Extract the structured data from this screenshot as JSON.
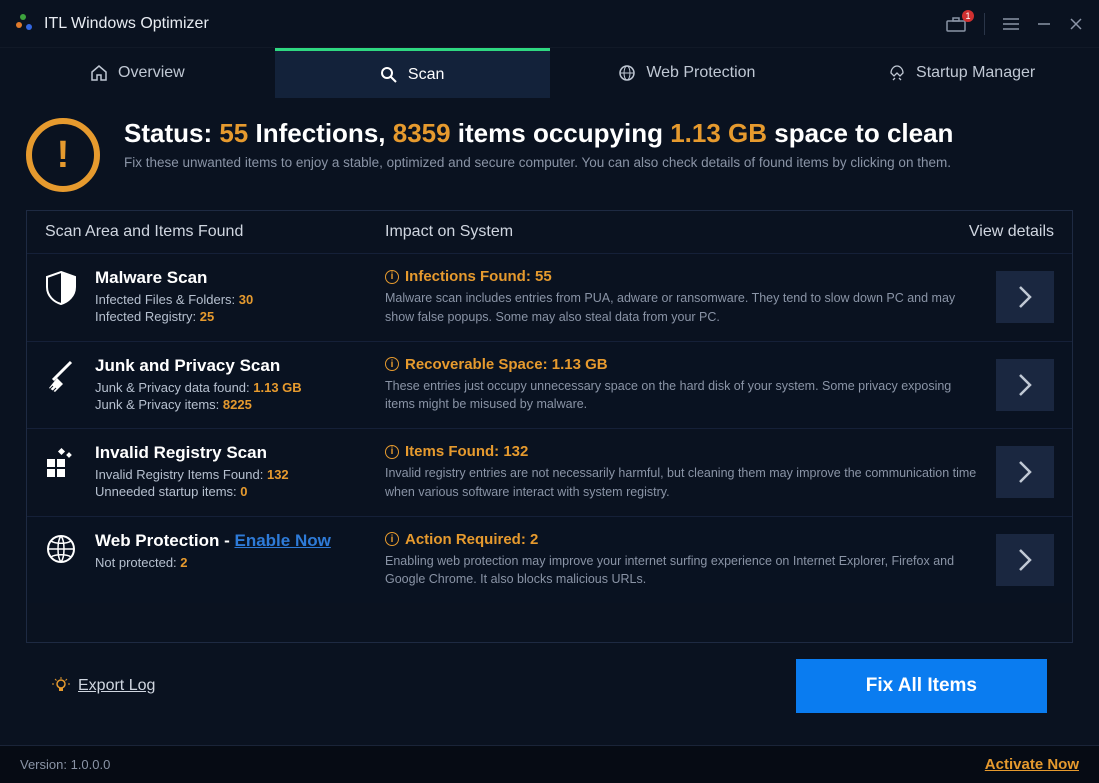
{
  "app": {
    "title": "ITL Windows Optimizer",
    "notification_count": "1"
  },
  "tabs": {
    "overview": "Overview",
    "scan": "Scan",
    "web_protection": "Web Protection",
    "startup_manager": "Startup Manager"
  },
  "status": {
    "prefix": "Status: ",
    "infections_count": "55",
    "infections_word": " Infections, ",
    "items_count": "8359",
    "items_word": " items occupying ",
    "size": "1.13 GB",
    "suffix": " space to clean",
    "subtitle": "Fix these unwanted items to enjoy a stable, optimized and secure computer. You can also check details of found items by clicking on them."
  },
  "headers": {
    "col1": "Scan Area and Items Found",
    "col2": "Impact on System",
    "col3": "View details"
  },
  "rows": {
    "malware": {
      "title": "Malware Scan",
      "line1_label": "Infected Files & Folders: ",
      "line1_value": "30",
      "line2_label": "Infected Registry: ",
      "line2_value": "25",
      "impact_title": "Infections Found: 55",
      "impact_desc": "Malware scan includes entries from PUA, adware or ransomware. They tend to slow down PC and may show false popups. Some may also steal data from your PC."
    },
    "junk": {
      "title": "Junk and Privacy Scan",
      "line1_label": "Junk & Privacy data found: ",
      "line1_value": "1.13 GB",
      "line2_label": "Junk & Privacy items: ",
      "line2_value": "8225",
      "impact_title": "Recoverable Space: 1.13 GB",
      "impact_desc": "These entries just occupy unnecessary space on the hard disk of your system. Some privacy exposing items might be misused by malware."
    },
    "registry": {
      "title": "Invalid Registry Scan",
      "line1_label": "Invalid Registry Items Found: ",
      "line1_value": "132",
      "line2_label": "Unneeded startup items: ",
      "line2_value": "0",
      "impact_title": "Items Found: 132",
      "impact_desc": "Invalid registry entries are not necessarily harmful, but cleaning them may improve the communication time when various software interact with system registry."
    },
    "web": {
      "title": "Web Protection  -  ",
      "enable_label": "Enable Now",
      "line1_label": "Not protected: ",
      "line1_value": "2",
      "impact_title": "Action Required: 2",
      "impact_desc": "Enabling web protection may improve your internet surfing experience on Internet Explorer, Firefox and Google Chrome. It also blocks malicious URLs."
    }
  },
  "bottom": {
    "export": "Export Log",
    "fix": "Fix All Items"
  },
  "footer": {
    "version_label": "Version: ",
    "version_value": "1.0.0.0",
    "activate": "Activate Now"
  }
}
